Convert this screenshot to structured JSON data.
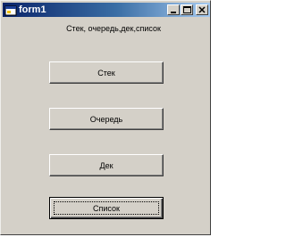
{
  "window": {
    "title": "form1",
    "icon": "form-app-icon",
    "controls": [
      "minimize-icon",
      "maximize-icon",
      "close-icon"
    ]
  },
  "header": {
    "text": "Стек, очередь,дек,список"
  },
  "buttons": {
    "stack": "Стек",
    "queue": "Очередь",
    "deque": "Дек",
    "list": "Список"
  },
  "colors": {
    "face": "#d4d0c8",
    "title_start": "#0a246a",
    "title_end": "#a6caf0"
  }
}
